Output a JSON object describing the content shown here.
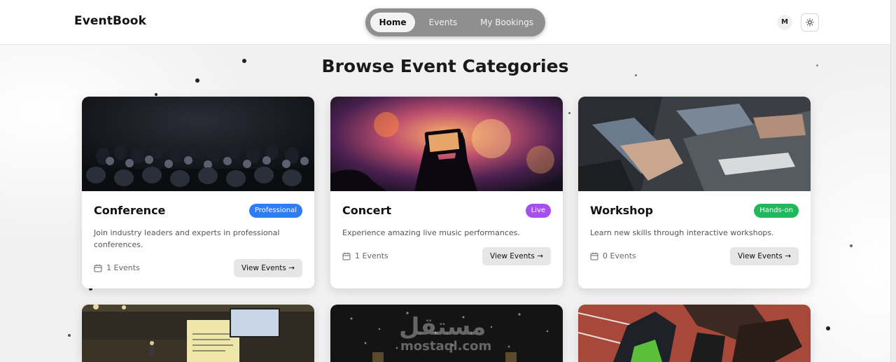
{
  "app": {
    "brand": "EventBook"
  },
  "nav": {
    "items": [
      {
        "label": "Home",
        "active": true
      },
      {
        "label": "Events",
        "active": false
      },
      {
        "label": "My Bookings",
        "active": false
      }
    ]
  },
  "user": {
    "avatar_initial": "M"
  },
  "page": {
    "title": "Browse Event Categories"
  },
  "categories": [
    {
      "title": "Conference",
      "badge": "Professional",
      "badge_color": "#2f7df6",
      "description": "Join industry leaders and experts in professional conferences.",
      "count": "1 Events",
      "button": "View Events →"
    },
    {
      "title": "Concert",
      "badge": "Live",
      "badge_color": "#a64ff0",
      "description": "Experience amazing live music performances.",
      "count": "1 Events",
      "button": "View Events →"
    },
    {
      "title": "Workshop",
      "badge": "Hands-on",
      "badge_color": "#20b85a",
      "description": "Learn new skills through interactive workshops.",
      "count": "0 Events",
      "button": "View Events →"
    }
  ],
  "watermark": {
    "arabic": "مستقل",
    "latin": "mostaql.com"
  },
  "icons": {
    "calendar": "calendar-icon",
    "theme": "sun-icon"
  }
}
